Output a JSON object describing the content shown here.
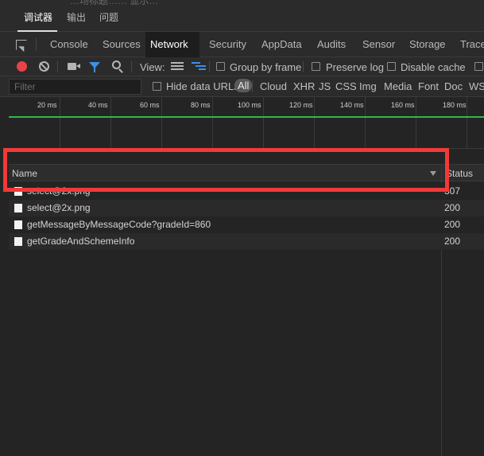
{
  "background_text": "…场标题…… 显示…",
  "top_tabs": [
    {
      "label": "调试器",
      "active": true
    },
    {
      "label": "输出",
      "active": false
    },
    {
      "label": "问题",
      "active": false
    }
  ],
  "panel_tabs": [
    {
      "label": "Console",
      "active": false
    },
    {
      "label": "Sources",
      "active": false
    },
    {
      "label": "Network",
      "active": true
    },
    {
      "label": "Security",
      "active": false
    },
    {
      "label": "AppData",
      "active": false
    },
    {
      "label": "Audits",
      "active": false
    },
    {
      "label": "Sensor",
      "active": false
    },
    {
      "label": "Storage",
      "active": false
    },
    {
      "label": "Trace",
      "active": false
    }
  ],
  "controls": {
    "view_label": "View:",
    "group_by_frame": "Group by frame",
    "preserve_log": "Preserve log",
    "disable_cache": "Disable cache",
    "group_by_frame_checked": false,
    "preserve_log_checked": false,
    "disable_cache_checked": false
  },
  "filter_bar": {
    "filter_placeholder": "Filter",
    "hide_data_urls": "Hide data URLs",
    "hide_data_urls_checked": false,
    "types": [
      "All",
      "Cloud",
      "XHR",
      "JS",
      "CSS",
      "Img",
      "Media",
      "Font",
      "Doc",
      "WS"
    ],
    "active_type": "All"
  },
  "overview": {
    "ticks": [
      "20 ms",
      "40 ms",
      "60 ms",
      "80 ms",
      "100 ms",
      "120 ms",
      "140 ms",
      "160 ms",
      "180 ms"
    ]
  },
  "table": {
    "name_header": "Name",
    "status_header": "Status",
    "rows": [
      {
        "name": "select@2x.png",
        "status": "307"
      },
      {
        "name": "select@2x.png",
        "status": "200"
      },
      {
        "name": "getMessageByMessageCode?gradeId=860",
        "status": "200"
      },
      {
        "name": "getGradeAndSchemeInfo",
        "status": "200"
      }
    ]
  },
  "colors": {
    "record": "#e8424a",
    "filter_active": "#3d8fe8",
    "load_line": "#2fb84a",
    "highlight": "#f03a3a"
  },
  "icons": [
    "inspect-icon",
    "record-icon",
    "clear-icon",
    "camera-icon",
    "filter-icon",
    "search-icon",
    "list-view-icon",
    "waterfall-icon",
    "sort-arrow-icon",
    "file-icon"
  ]
}
